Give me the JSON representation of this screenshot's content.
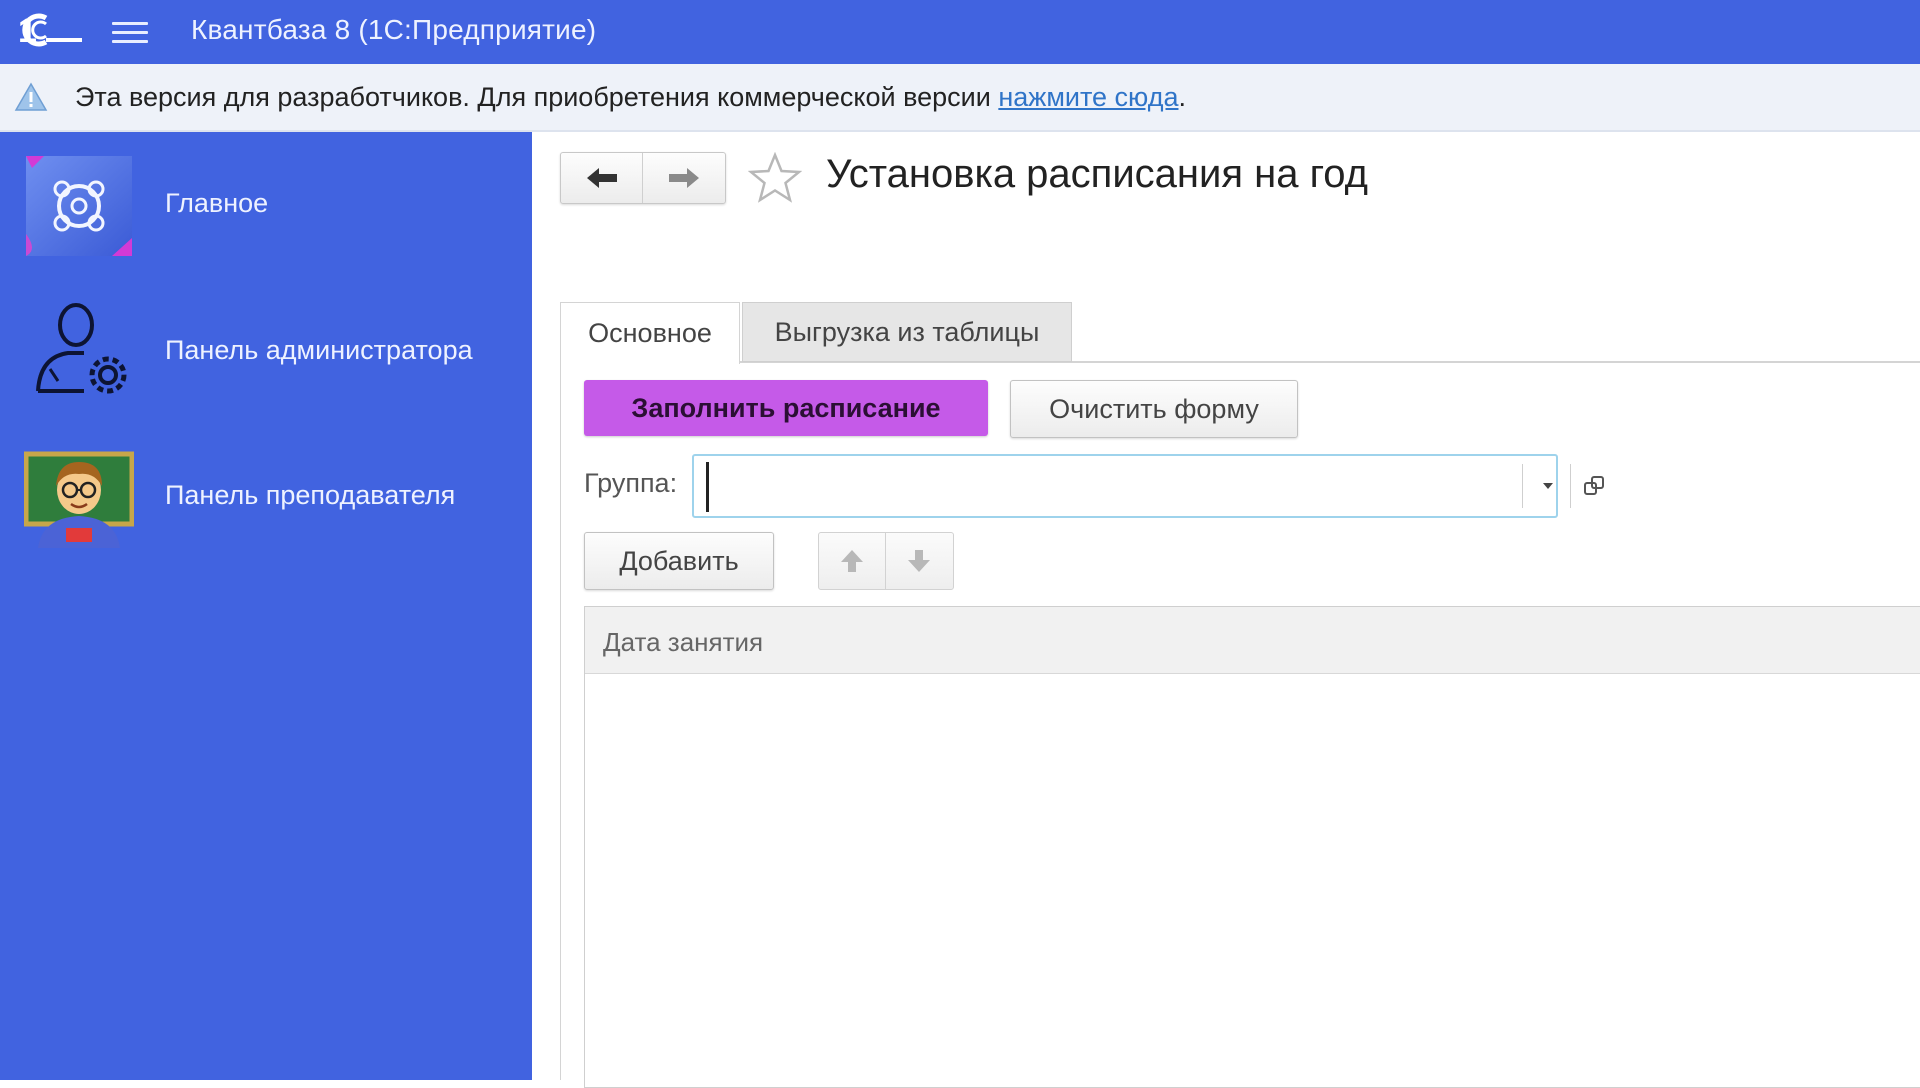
{
  "titlebar": {
    "title": "Квантбаза 8  (1С:Предприятие)",
    "logo_icon": "1c-logo-icon",
    "menu_icon": "hamburger-menu-icon",
    "color": "#4163e0"
  },
  "banner": {
    "text": "Эта версия для разработчиков. Для приобретения коммерческой версии ",
    "link": "нажмите сюда",
    "suffix": ".",
    "icon": "warning-icon"
  },
  "sidebar": {
    "color": "#4163e0",
    "items": [
      {
        "label": "Главное",
        "icon": "main-section-icon"
      },
      {
        "label": "Панель администратора",
        "icon": "admin-user-gear-icon"
      },
      {
        "label": "Панель преподавателя",
        "icon": "teacher-icon"
      }
    ]
  },
  "form": {
    "title": "Установка расписания на год",
    "tabs": [
      {
        "label": "Основное",
        "active": true
      },
      {
        "label": "Выгрузка из таблицы",
        "active": false
      }
    ],
    "fill_button": "Заполнить расписание",
    "fill_button_color": "#c55ae8",
    "clear_button": "Очистить форму",
    "group_label": "Группа:",
    "group_value": "",
    "add_button": "Добавить",
    "table": {
      "columns": [
        "Дата занятия"
      ],
      "rows": []
    }
  }
}
